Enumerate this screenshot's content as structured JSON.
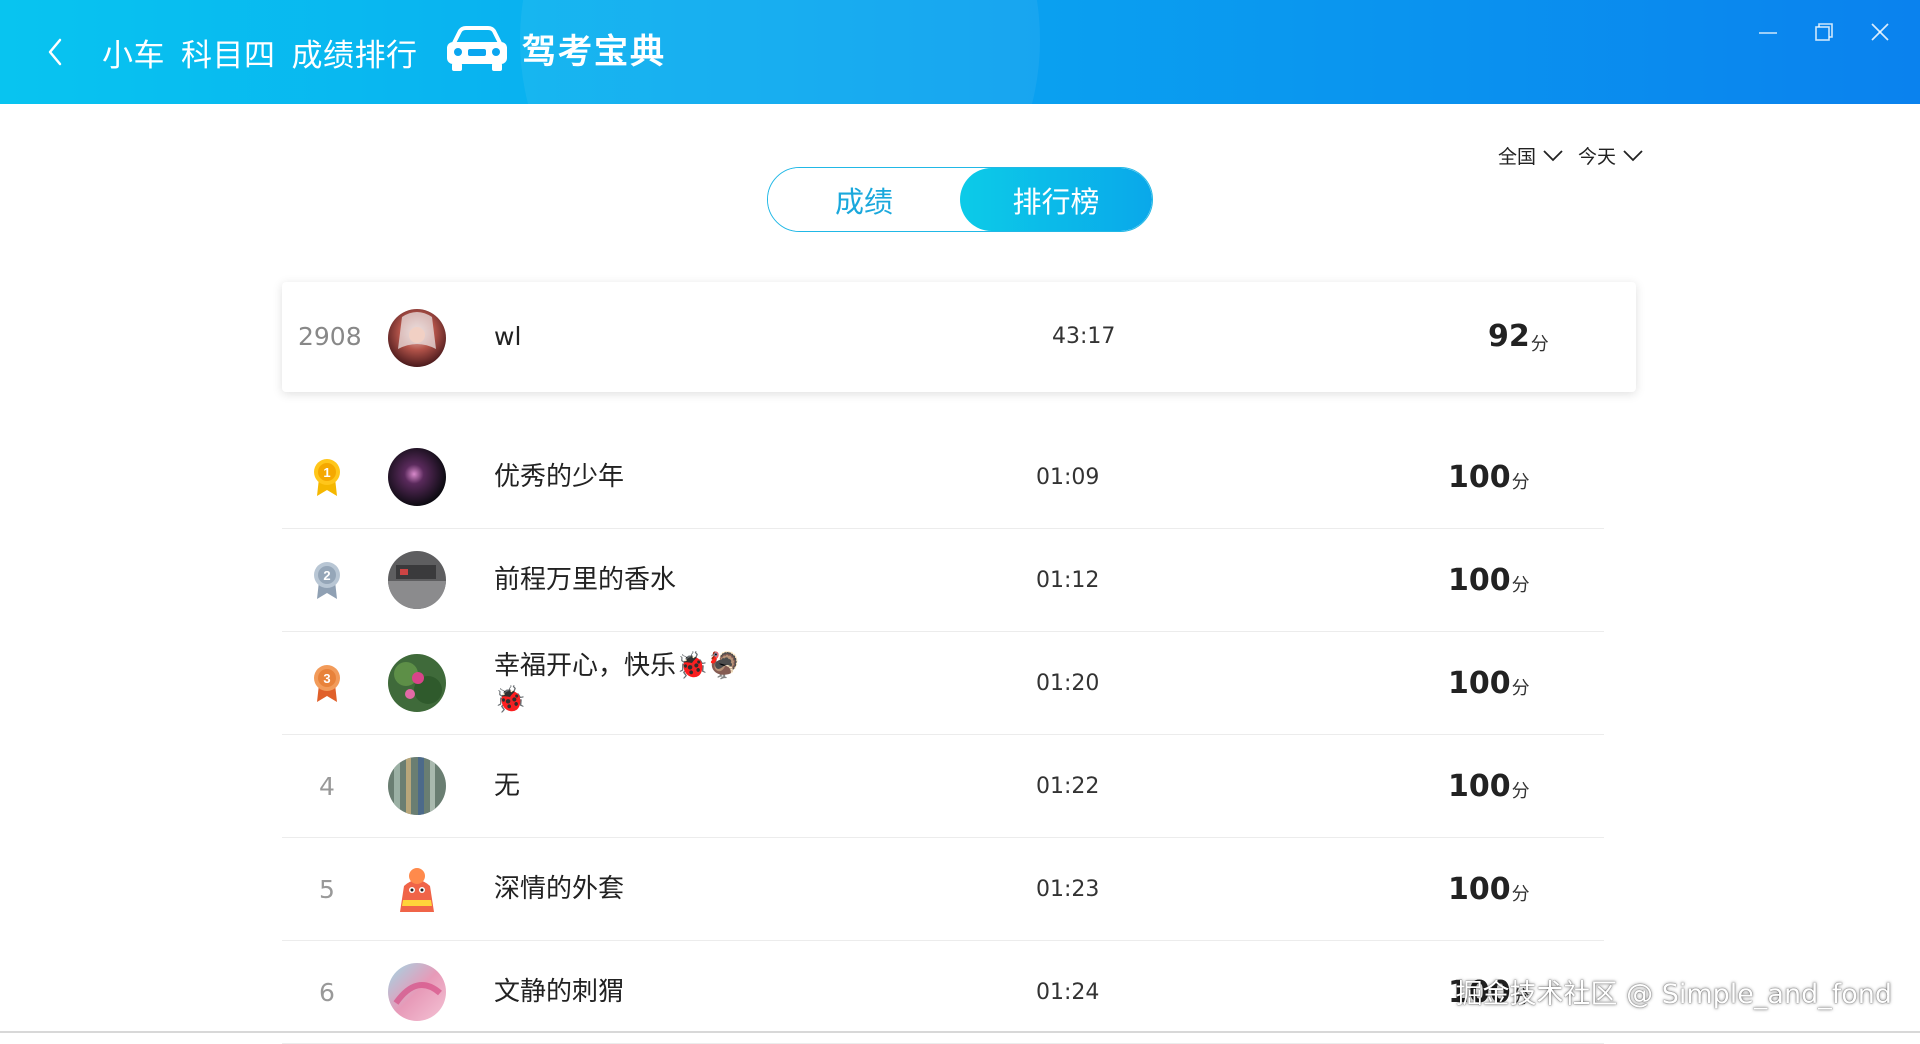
{
  "header": {
    "title_parts": [
      "小车",
      "科目四",
      "成绩排行"
    ],
    "logo_text": "驾考宝典"
  },
  "filters": [
    {
      "label": "全国"
    },
    {
      "label": "今天"
    }
  ],
  "tabs": [
    {
      "label": "成绩",
      "active": false
    },
    {
      "label": "排行榜",
      "active": true
    }
  ],
  "my_rank": {
    "rank": "2908",
    "name": "wl",
    "time": "43:17",
    "score": "92",
    "unit": "分"
  },
  "leaderboard": [
    {
      "rank": "1",
      "medal": "gold",
      "name": "优秀的少年",
      "time": "01:09",
      "score": "100",
      "unit": "分"
    },
    {
      "rank": "2",
      "medal": "silver",
      "name": "前程万里的香水",
      "time": "01:12",
      "score": "100",
      "unit": "分"
    },
    {
      "rank": "3",
      "medal": "bronze",
      "name": "幸福开心，快乐🐞🦃🐞",
      "time": "01:20",
      "score": "100",
      "unit": "分"
    },
    {
      "rank": "4",
      "medal": "",
      "name": "无",
      "time": "01:22",
      "score": "100",
      "unit": "分"
    },
    {
      "rank": "5",
      "medal": "",
      "name": "深情的外套",
      "time": "01:23",
      "score": "100",
      "unit": "分"
    },
    {
      "rank": "6",
      "medal": "",
      "name": "文静的刺猬",
      "time": "01:24",
      "score": "100",
      "unit": "分"
    }
  ],
  "watermark": "掘金技术社区 @ Simple_and_fond",
  "colors": {
    "header_start": "#08c4f0",
    "header_end": "#0a82ee",
    "accent": "#1aa8dc",
    "gold": "#f5b700",
    "silver": "#9aa8b8",
    "bronze": "#e8823a"
  }
}
